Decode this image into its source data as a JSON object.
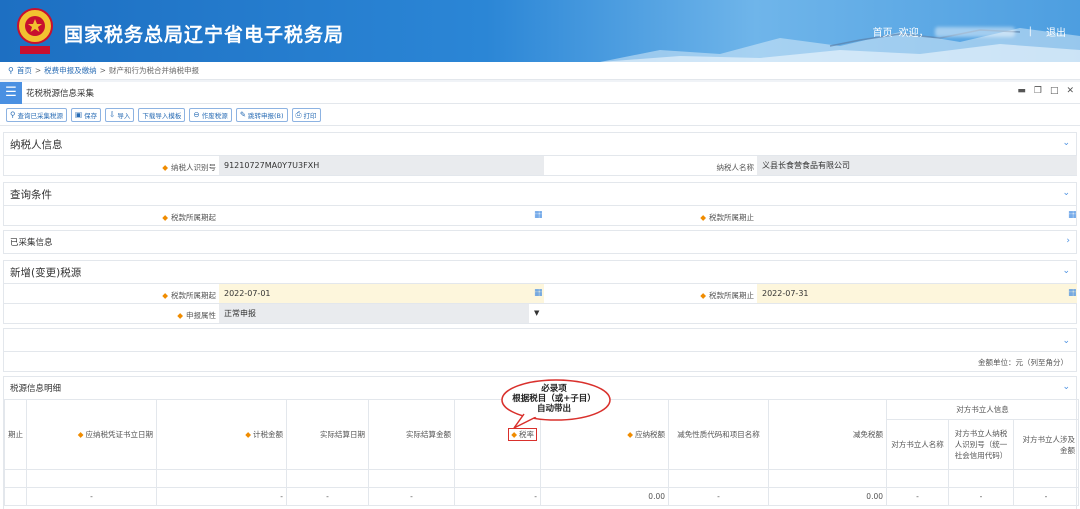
{
  "header": {
    "site_title": "国家税务总局辽宁省电子税务局",
    "home_link": "首页",
    "welcome": "欢迎，",
    "logout": "退出",
    "emblem_text": "中国税务"
  },
  "breadcrumb": {
    "home": "首页",
    "level1": "税费申报及缴纳",
    "current": "财产和行为税合并纳税申报",
    "sep": ">"
  },
  "panel": {
    "title": "花税税源信息采集"
  },
  "toolbar": {
    "query": "查询已采集税源",
    "save": "保存",
    "import": "导入",
    "download_template": "下载导入模板",
    "void": "作废税源",
    "goto_declare": "跳转申报(B)",
    "print": "打印"
  },
  "taxpayer": {
    "section_title": "纳税人信息",
    "id_label": "纳税人识别号",
    "id_value": "91210727MA0Y7U3FXH",
    "name_label": "纳税人名称",
    "name_value": "义县长食营食品有限公司"
  },
  "query": {
    "section_title": "查询条件",
    "start_label": "税款所属期起",
    "end_label": "税款所属期止"
  },
  "collected": {
    "section_title": "已采集信息"
  },
  "new_source": {
    "section_title": "新增(变更)税源",
    "start_label": "税款所属期起",
    "start_value": "2022-07-01",
    "end_label": "税款所属期止",
    "end_value": "2022-07-31",
    "attr_label": "申报属性",
    "attr_value": "正常申报",
    "unit_note": "金额单位：元（列至角分）"
  },
  "detail": {
    "section_title": "税源信息明细",
    "columns": {
      "period_end": "期止",
      "voucher_date": "应纳税凭证书立日期",
      "tax_amount": "计税金额",
      "actual_settle_date": "实际结算日期",
      "actual_settle_amount": "实际结算金额",
      "rate": "税率",
      "payable": "应纳税额",
      "relief_code": "减免性质代码和项目名称",
      "relief_amount": "减免税额",
      "counterparty_group": "对方书立人信息",
      "cp_name": "对方书立人名称",
      "cp_id": "对方书立人纳税人识别号（统一社会信用代码）",
      "cp_amount": "对方书立人涉及金额"
    },
    "row": {
      "voucher_date": "-",
      "tax_amount": "-",
      "actual_settle_date": "-",
      "actual_settle_amount": "-",
      "rate": "-",
      "payable": "0.00",
      "relief_code": "-",
      "relief_amount": "0.00",
      "cp_name": "-",
      "cp_id": "-",
      "cp_amount": "-"
    }
  },
  "annotation": {
    "line1": "必录项",
    "line2": "根据税目（或+子目）",
    "line3": "自动带出"
  },
  "colors": {
    "accent": "#4a90e2",
    "required": "#f08c00",
    "highlight": "#d9302c"
  }
}
